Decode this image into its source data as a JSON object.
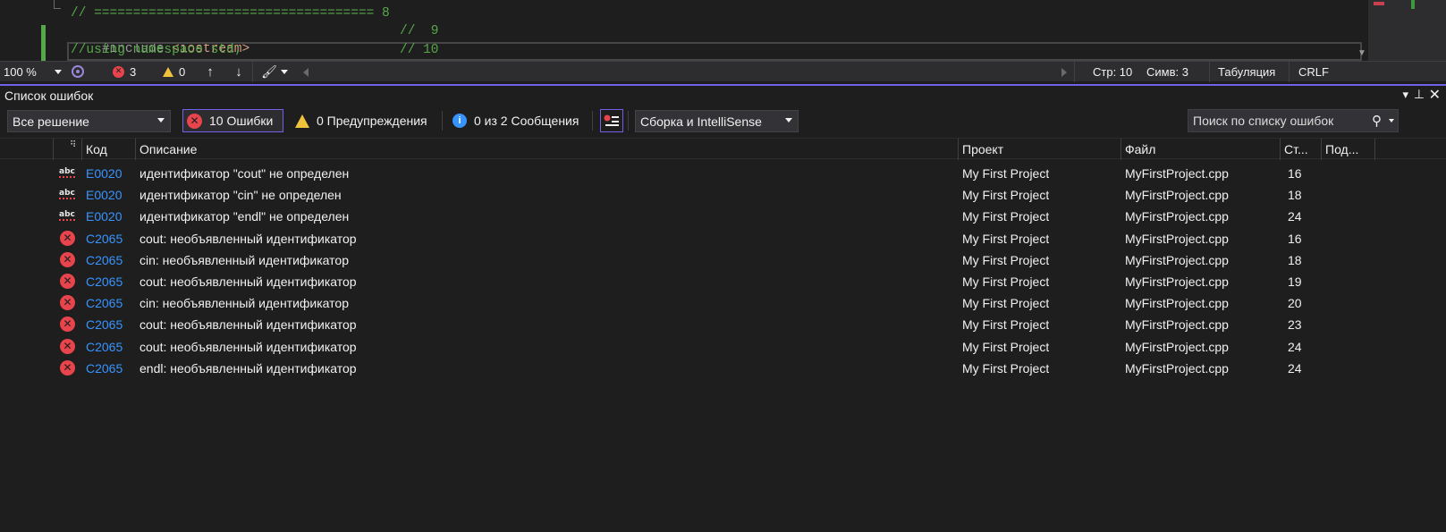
{
  "editor": {
    "lines": [
      {
        "text": "// ==================================== 8",
        "kind": "comment"
      },
      {
        "directive": "#include",
        "header": "<iostream>",
        "comment": "//  9"
      },
      {
        "text": "//using namespace std;",
        "comment": "// 10"
      }
    ]
  },
  "status_bar": {
    "zoom": "100 %",
    "errors_count": "3",
    "warnings_count": "0",
    "line": "Стр: 10",
    "col": "Симв: 3",
    "indent": "Табуляция",
    "eol": "CRLF"
  },
  "error_list": {
    "title": "Список ошибок",
    "scope": "Все решение",
    "errors_filter": "10 Ошибки",
    "warnings_filter": "0 Предупреждения",
    "messages_filter": "0 из 2 Сообщения",
    "build_source": "Сборка и IntelliSense",
    "search_placeholder": "Поиск по списку ошибок",
    "columns": {
      "code": "Код",
      "description": "Описание",
      "project": "Проект",
      "file": "Файл",
      "line": "Ст...",
      "suppression": "Под..."
    },
    "rows": [
      {
        "icon": "intellisense-error-icon",
        "code": "E0020",
        "description": "идентификатор \"cout\" не определен",
        "project": "My First Project",
        "file": "MyFirstProject.cpp",
        "line": "16"
      },
      {
        "icon": "intellisense-error-icon",
        "code": "E0020",
        "description": "идентификатор \"cin\" не определен",
        "project": "My First Project",
        "file": "MyFirstProject.cpp",
        "line": "18"
      },
      {
        "icon": "intellisense-error-icon",
        "code": "E0020",
        "description": "идентификатор \"endl\" не определен",
        "project": "My First Project",
        "file": "MyFirstProject.cpp",
        "line": "24"
      },
      {
        "icon": "error-icon",
        "code": "C2065",
        "description": "cout: необъявленный идентификатор",
        "project": "My First Project",
        "file": "MyFirstProject.cpp",
        "line": "16"
      },
      {
        "icon": "error-icon",
        "code": "C2065",
        "description": "cin: необъявленный идентификатор",
        "project": "My First Project",
        "file": "MyFirstProject.cpp",
        "line": "18"
      },
      {
        "icon": "error-icon",
        "code": "C2065",
        "description": "cout: необъявленный идентификатор",
        "project": "My First Project",
        "file": "MyFirstProject.cpp",
        "line": "19"
      },
      {
        "icon": "error-icon",
        "code": "C2065",
        "description": "cin: необъявленный идентификатор",
        "project": "My First Project",
        "file": "MyFirstProject.cpp",
        "line": "20"
      },
      {
        "icon": "error-icon",
        "code": "C2065",
        "description": "cout: необъявленный идентификатор",
        "project": "My First Project",
        "file": "MyFirstProject.cpp",
        "line": "23"
      },
      {
        "icon": "error-icon",
        "code": "C2065",
        "description": "cout: необъявленный идентификатор",
        "project": "My First Project",
        "file": "MyFirstProject.cpp",
        "line": "24"
      },
      {
        "icon": "error-icon",
        "code": "C2065",
        "description": "endl: необъявленный идентификатор",
        "project": "My First Project",
        "file": "MyFirstProject.cpp",
        "line": "24"
      }
    ]
  },
  "colors": {
    "accent": "#7160e8",
    "error": "#e8444c",
    "warning": "#f0c33c",
    "info": "#3794ff",
    "link": "#3794ff",
    "comment": "#57a64a"
  }
}
